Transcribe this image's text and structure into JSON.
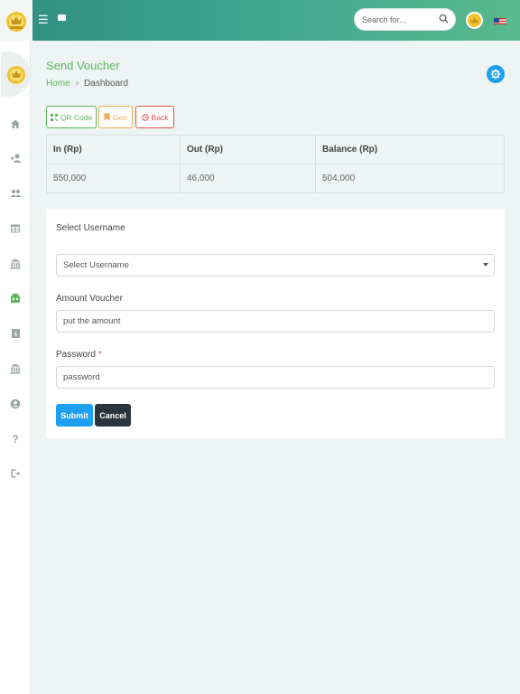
{
  "header": {
    "search_placeholder": "Search for...",
    "brand_color": "#3da08f"
  },
  "sidebar": {
    "items": [
      {
        "icon": "home-icon"
      },
      {
        "icon": "add-user-icon"
      },
      {
        "icon": "users-icon"
      },
      {
        "icon": "table-icon"
      },
      {
        "icon": "bank-icon"
      },
      {
        "icon": "voucher-icon",
        "active": true
      },
      {
        "icon": "money-icon"
      },
      {
        "icon": "bank-icon"
      },
      {
        "icon": "account-icon"
      },
      {
        "icon": "help-icon"
      },
      {
        "icon": "logout-icon"
      }
    ]
  },
  "page": {
    "title": "Send Voucher",
    "breadcrumb_home": "Home",
    "breadcrumb_current": "Dashboard"
  },
  "actions": {
    "qr_label": "QR Code",
    "gen_label": "Gen",
    "back_label": "Back"
  },
  "summary": {
    "headers": [
      "In (Rp)",
      "Out (Rp)",
      "Balance (Rp)"
    ],
    "values": [
      "550,000",
      "46,000",
      "504,000"
    ]
  },
  "form": {
    "username_section": "Select Username",
    "username_value": "Select Username",
    "amount_label": "Amount Voucher",
    "amount_placeholder": "put the amount",
    "password_label": "Password",
    "password_required": "*",
    "password_placeholder": "password",
    "submit_label": "Submit",
    "cancel_label": "Cancel"
  },
  "colors": {
    "success": "#5cb85c",
    "warning": "#f0ad4e",
    "danger": "#d9534f",
    "primary": "#1e9ff2",
    "dark": "#2b3540"
  }
}
